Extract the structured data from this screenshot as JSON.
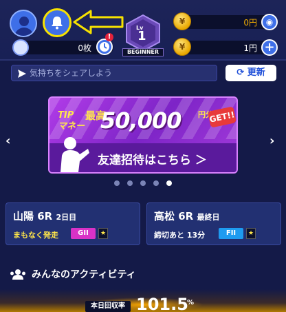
{
  "header": {
    "coupon_count": "0枚",
    "rank": {
      "lv_label": "Lv",
      "level": "1",
      "name": "BEGINNER"
    },
    "tip_money": "0円",
    "yen_money": "1円",
    "notify_badge": "!"
  },
  "share": {
    "placeholder": "気持ちをシェアしよう",
    "refresh_label": "更新"
  },
  "banner": {
    "tip_label": "TIP\nマネー",
    "max_label": "最高",
    "amount": "50,000",
    "unit": "円分",
    "get_label": "GET!!",
    "invite_label": "友達招待はこちら ＞"
  },
  "carousel": {
    "prev": "‹",
    "next": "›",
    "dots": 5,
    "active_index": 4
  },
  "races": [
    {
      "venue": "山陽 6R",
      "day": "2日目",
      "status": "まもなく発走",
      "grade": "GII",
      "star": "★"
    },
    {
      "venue": "高松 6R",
      "day": "最終日",
      "status": "締切あと 13分",
      "grade": "FII",
      "star": "★"
    }
  ],
  "activity": {
    "title": "みんなのアクティビティ"
  },
  "bottom": {
    "rate_label": "本日回収率",
    "rate_value": "101.5",
    "rate_unit": "%"
  },
  "colors": {
    "accent": "#3e6fe8",
    "highlight": "#f7e200",
    "background": "#141a48",
    "gold": "#f5b000"
  }
}
